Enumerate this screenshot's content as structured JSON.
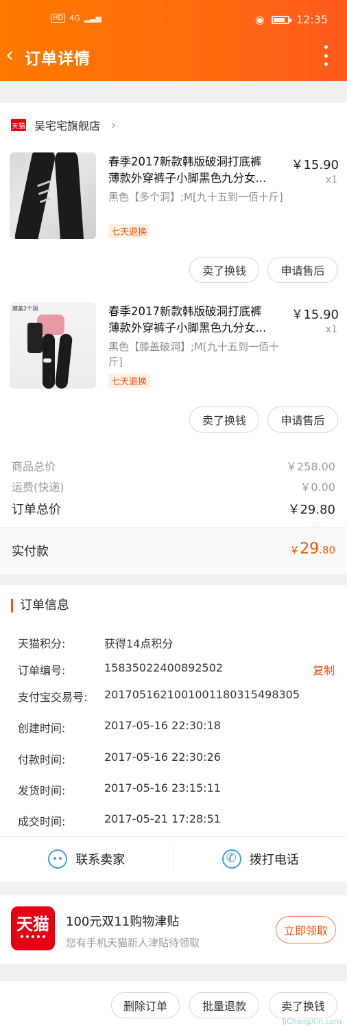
{
  "status": {
    "net": "4G",
    "hd": "HD",
    "time": "12:35"
  },
  "nav": {
    "title": "订单详情"
  },
  "shop": {
    "badge": "天猫",
    "name": "吴宅宅旗舰店"
  },
  "items": [
    {
      "title1": "春季2017新款韩版破洞打底裤",
      "title2": "薄款外穿裤子小脚黑色九分女...",
      "spec": "黑色【多个洞】;M[九十五到一佰十斤]",
      "badge": "七天退换",
      "price": "￥15.90",
      "qty": "x1",
      "btn_exchange": "卖了换钱",
      "btn_after": "申请售后"
    },
    {
      "title1": "春季2017新款韩版破洞打底裤",
      "title2": "薄款外穿裤子小脚黑色九分女...",
      "spec": "黑色【膝盖破洞】;M[九十五到一佰十斤]",
      "badge": "七天退换",
      "thumb_text": "膝盖2个洞",
      "price": "￥15.90",
      "qty": "x1",
      "btn_exchange": "卖了换钱",
      "btn_after": "申请售后"
    }
  ],
  "summary": {
    "goods_label": "商品总价",
    "goods_value": "￥258.00",
    "ship_label": "运费(快递)",
    "ship_value": "￥0.00",
    "total_label": "订单总价",
    "total_value": "￥29.80",
    "paid_label": "实付款",
    "paid_currency": "￥",
    "paid_int": "29",
    "paid_dec": ".80"
  },
  "info": {
    "title": "订单信息",
    "rows": [
      {
        "k": "天猫积分:",
        "v": "获得14点积分"
      },
      {
        "k": "订单编号:",
        "v": "1583502240089250​2"
      },
      {
        "k": "支付宝交易号:",
        "v": "2017051621001001180315498305"
      },
      {
        "k": "创建时间:",
        "v": "2017-05-16 22:30:18"
      },
      {
        "k": "付款时间:",
        "v": "2017-05-16 22:30:26"
      },
      {
        "k": "发货时间:",
        "v": "2017-05-16 23:15:11"
      },
      {
        "k": "成交时间:",
        "v": "2017-05-21 17:28:51"
      }
    ],
    "copy": "复制"
  },
  "contact": {
    "seller": "联系卖家",
    "phone": "拨打电话"
  },
  "promo": {
    "logo": "天猫",
    "title": "100元双11购物津贴",
    "sub": "您有手机天猫新人津贴待领取",
    "btn": "立即领取"
  },
  "bottom": {
    "delete": "删除订单",
    "refund": "批量退款",
    "sell": "卖了换钱"
  },
  "watermark": "JiChengXin.com",
  "colors": {
    "accent": "#ff5000",
    "header": "#ff7a00",
    "tmall": "#e60012",
    "link": "#3aa0e6"
  }
}
